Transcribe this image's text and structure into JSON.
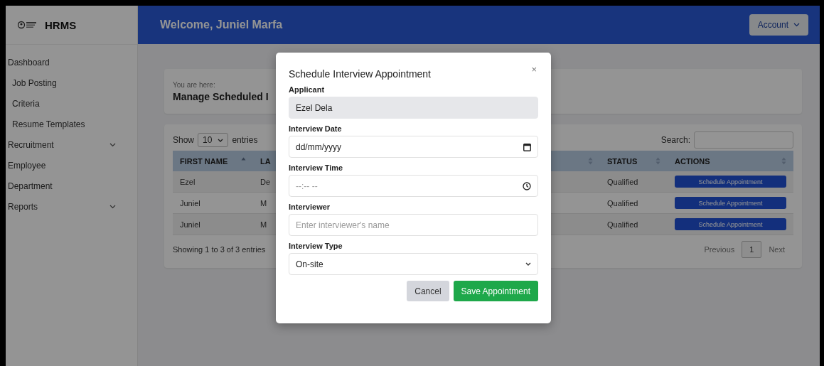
{
  "sidebar": {
    "brand": "HRMS",
    "items": [
      {
        "label": "Dashboard",
        "sub": false,
        "expandable": false
      },
      {
        "label": "Job Posting",
        "sub": true,
        "expandable": false
      },
      {
        "label": "Criteria",
        "sub": true,
        "expandable": false
      },
      {
        "label": "Resume Templates",
        "sub": true,
        "expandable": false
      },
      {
        "label": "Recruitment",
        "sub": false,
        "expandable": true
      },
      {
        "label": "Employee",
        "sub": false,
        "expandable": false
      },
      {
        "label": "Department",
        "sub": false,
        "expandable": false
      },
      {
        "label": "Reports",
        "sub": false,
        "expandable": true
      }
    ]
  },
  "header": {
    "welcome": "Welcome, Juniel Marfa",
    "account_button": "Account"
  },
  "breadcrumb": {
    "hint": "You are here:",
    "title": "Manage Scheduled I"
  },
  "table": {
    "show_label": "Show",
    "entries_value": "10",
    "entries_label": "entries",
    "search_label": "Search:",
    "columns": [
      {
        "label": "FIRST NAME",
        "sorted": true
      },
      {
        "label": "LA"
      },
      {
        "sorted": false
      },
      {
        "label": "STATUS",
        "sorted": false
      },
      {
        "label": "ACTIONS",
        "sorted": false
      }
    ],
    "rows": [
      {
        "cells": [
          "Ezel",
          "De",
          "Qualified"
        ],
        "action": "Schedule Appointment"
      },
      {
        "cells": [
          "Juniel",
          "M",
          "Qualified"
        ],
        "action": "Schedule Appointment"
      },
      {
        "cells": [
          "Juniel",
          "M",
          "Qualified"
        ],
        "action": "Schedule Appointment"
      }
    ],
    "info": "Showing 1 to 3 of 3 entries",
    "pagination": {
      "previous": "Previous",
      "pages": [
        {
          "label": "1",
          "selected": true
        }
      ],
      "next": "Next"
    }
  },
  "modal": {
    "title": "Schedule Interview Appointment",
    "close": "×",
    "fields": [
      {
        "kind": "readonly",
        "label": "Applicant",
        "value": "Ezel Dela"
      },
      {
        "kind": "date",
        "label": "Interview Date",
        "value": "dd/mm/yyyy"
      },
      {
        "kind": "time",
        "label": "Interview Time",
        "placeholder": "--:-- --"
      },
      {
        "kind": "text",
        "label": "Interviewer",
        "placeholder": "Enter interviewer's name"
      },
      {
        "kind": "select",
        "label": "Interview Type",
        "value": "On-site"
      }
    ],
    "cancel": "Cancel",
    "save": "Save Appointment"
  }
}
